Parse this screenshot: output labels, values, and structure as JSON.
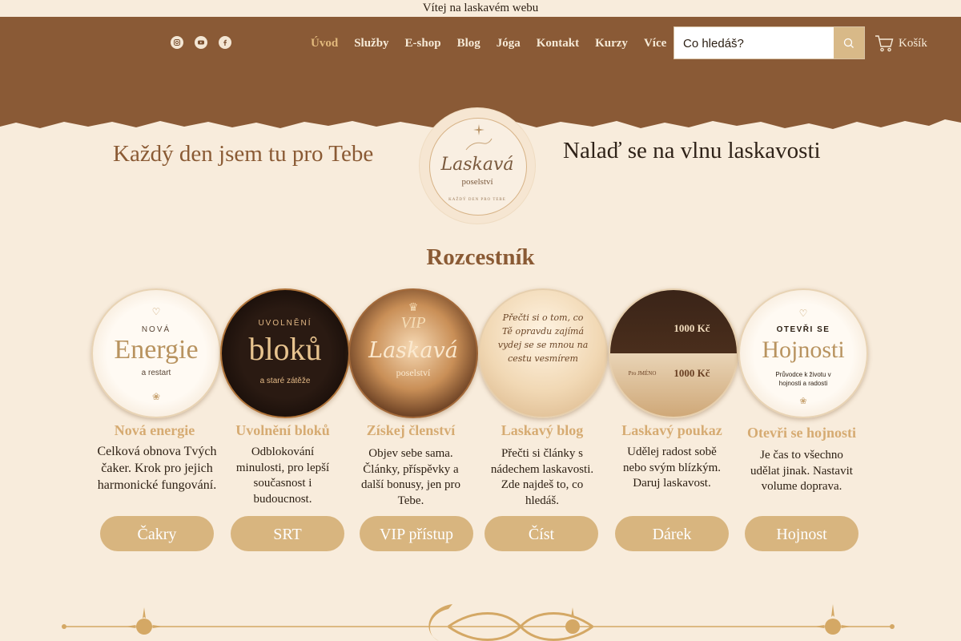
{
  "topbar": {
    "welcome": "Vítej na laskavém webu"
  },
  "social": [
    {
      "icon": "instagram-icon"
    },
    {
      "icon": "youtube-icon"
    },
    {
      "icon": "facebook-icon"
    }
  ],
  "nav": [
    {
      "label": "Úvod",
      "active": true
    },
    {
      "label": "Služby"
    },
    {
      "label": "E-shop"
    },
    {
      "label": "Blog"
    },
    {
      "label": "Jóga"
    },
    {
      "label": "Kontakt"
    },
    {
      "label": "Kurzy"
    },
    {
      "label": "Více"
    }
  ],
  "search": {
    "placeholder": "Co hledáš?"
  },
  "cart": {
    "label": "Košík"
  },
  "hero": {
    "left": "Každý den jsem tu pro Tebe",
    "right": "Nalaď se na vlnu laskavosti",
    "logo_name": "Laskavá",
    "logo_sub": "poselství",
    "logo_tiny": "KAŽDÝ DEN PRO TEBE"
  },
  "section_title": "Rozcestník",
  "cards": [
    {
      "img_top": "NOVÁ",
      "img_main": "Energie",
      "img_bottom": "a restart",
      "title": "Nová energie",
      "desc": "Celková obnova Tvých čaker. Krok pro jejich harmonické fungování.",
      "button": "Čakry"
    },
    {
      "img_top": "UVOLNĚNÍ",
      "img_main": "bloků",
      "img_bottom": "a staré zátěže",
      "title": "Uvolnění bloků",
      "desc": "Odblokování minulosti, pro lepší současnost i budoucnost.",
      "button": "SRT"
    },
    {
      "img_top": "VIP",
      "img_main": "Laskavá",
      "img_bottom": "poselství",
      "title": "Získej členství",
      "desc": "Objev sebe sama. Články, příspěvky a další bonusy, jen pro Tebe.",
      "button": "VIP přístup"
    },
    {
      "img_top": "",
      "img_main": "Přečti si o tom, co Tě opravdu zajímá vydej se se mnou na cestu vesmírem",
      "img_bottom": "",
      "title": "Laskavý blog",
      "desc": "Přečti si články s nádechem laskavosti. Zde najdeš to, co hledáš.",
      "button": "Číst"
    },
    {
      "img_top": "1000 Kč",
      "img_main": "1000 Kč",
      "img_bottom": "Pro JMÉNO",
      "title": "Laskavý poukaz",
      "desc": "Udělej radost sobě nebo svým blízkým. Daruj laskavost.",
      "button": "Dárek"
    },
    {
      "img_top": "OTEVŘI SE",
      "img_main": "Hojnosti",
      "img_bottom": "Průvodce k životu v hojnosti a radosti",
      "title": "Otevři se hojnosti",
      "desc": "Je čas to všechno udělat jinak. Nastavit volume doprava.",
      "button": "Hojnost"
    }
  ],
  "colors": {
    "header_brown": "#8a5a36",
    "accent_gold": "#d8b57f",
    "background": "#f8ecdc"
  }
}
